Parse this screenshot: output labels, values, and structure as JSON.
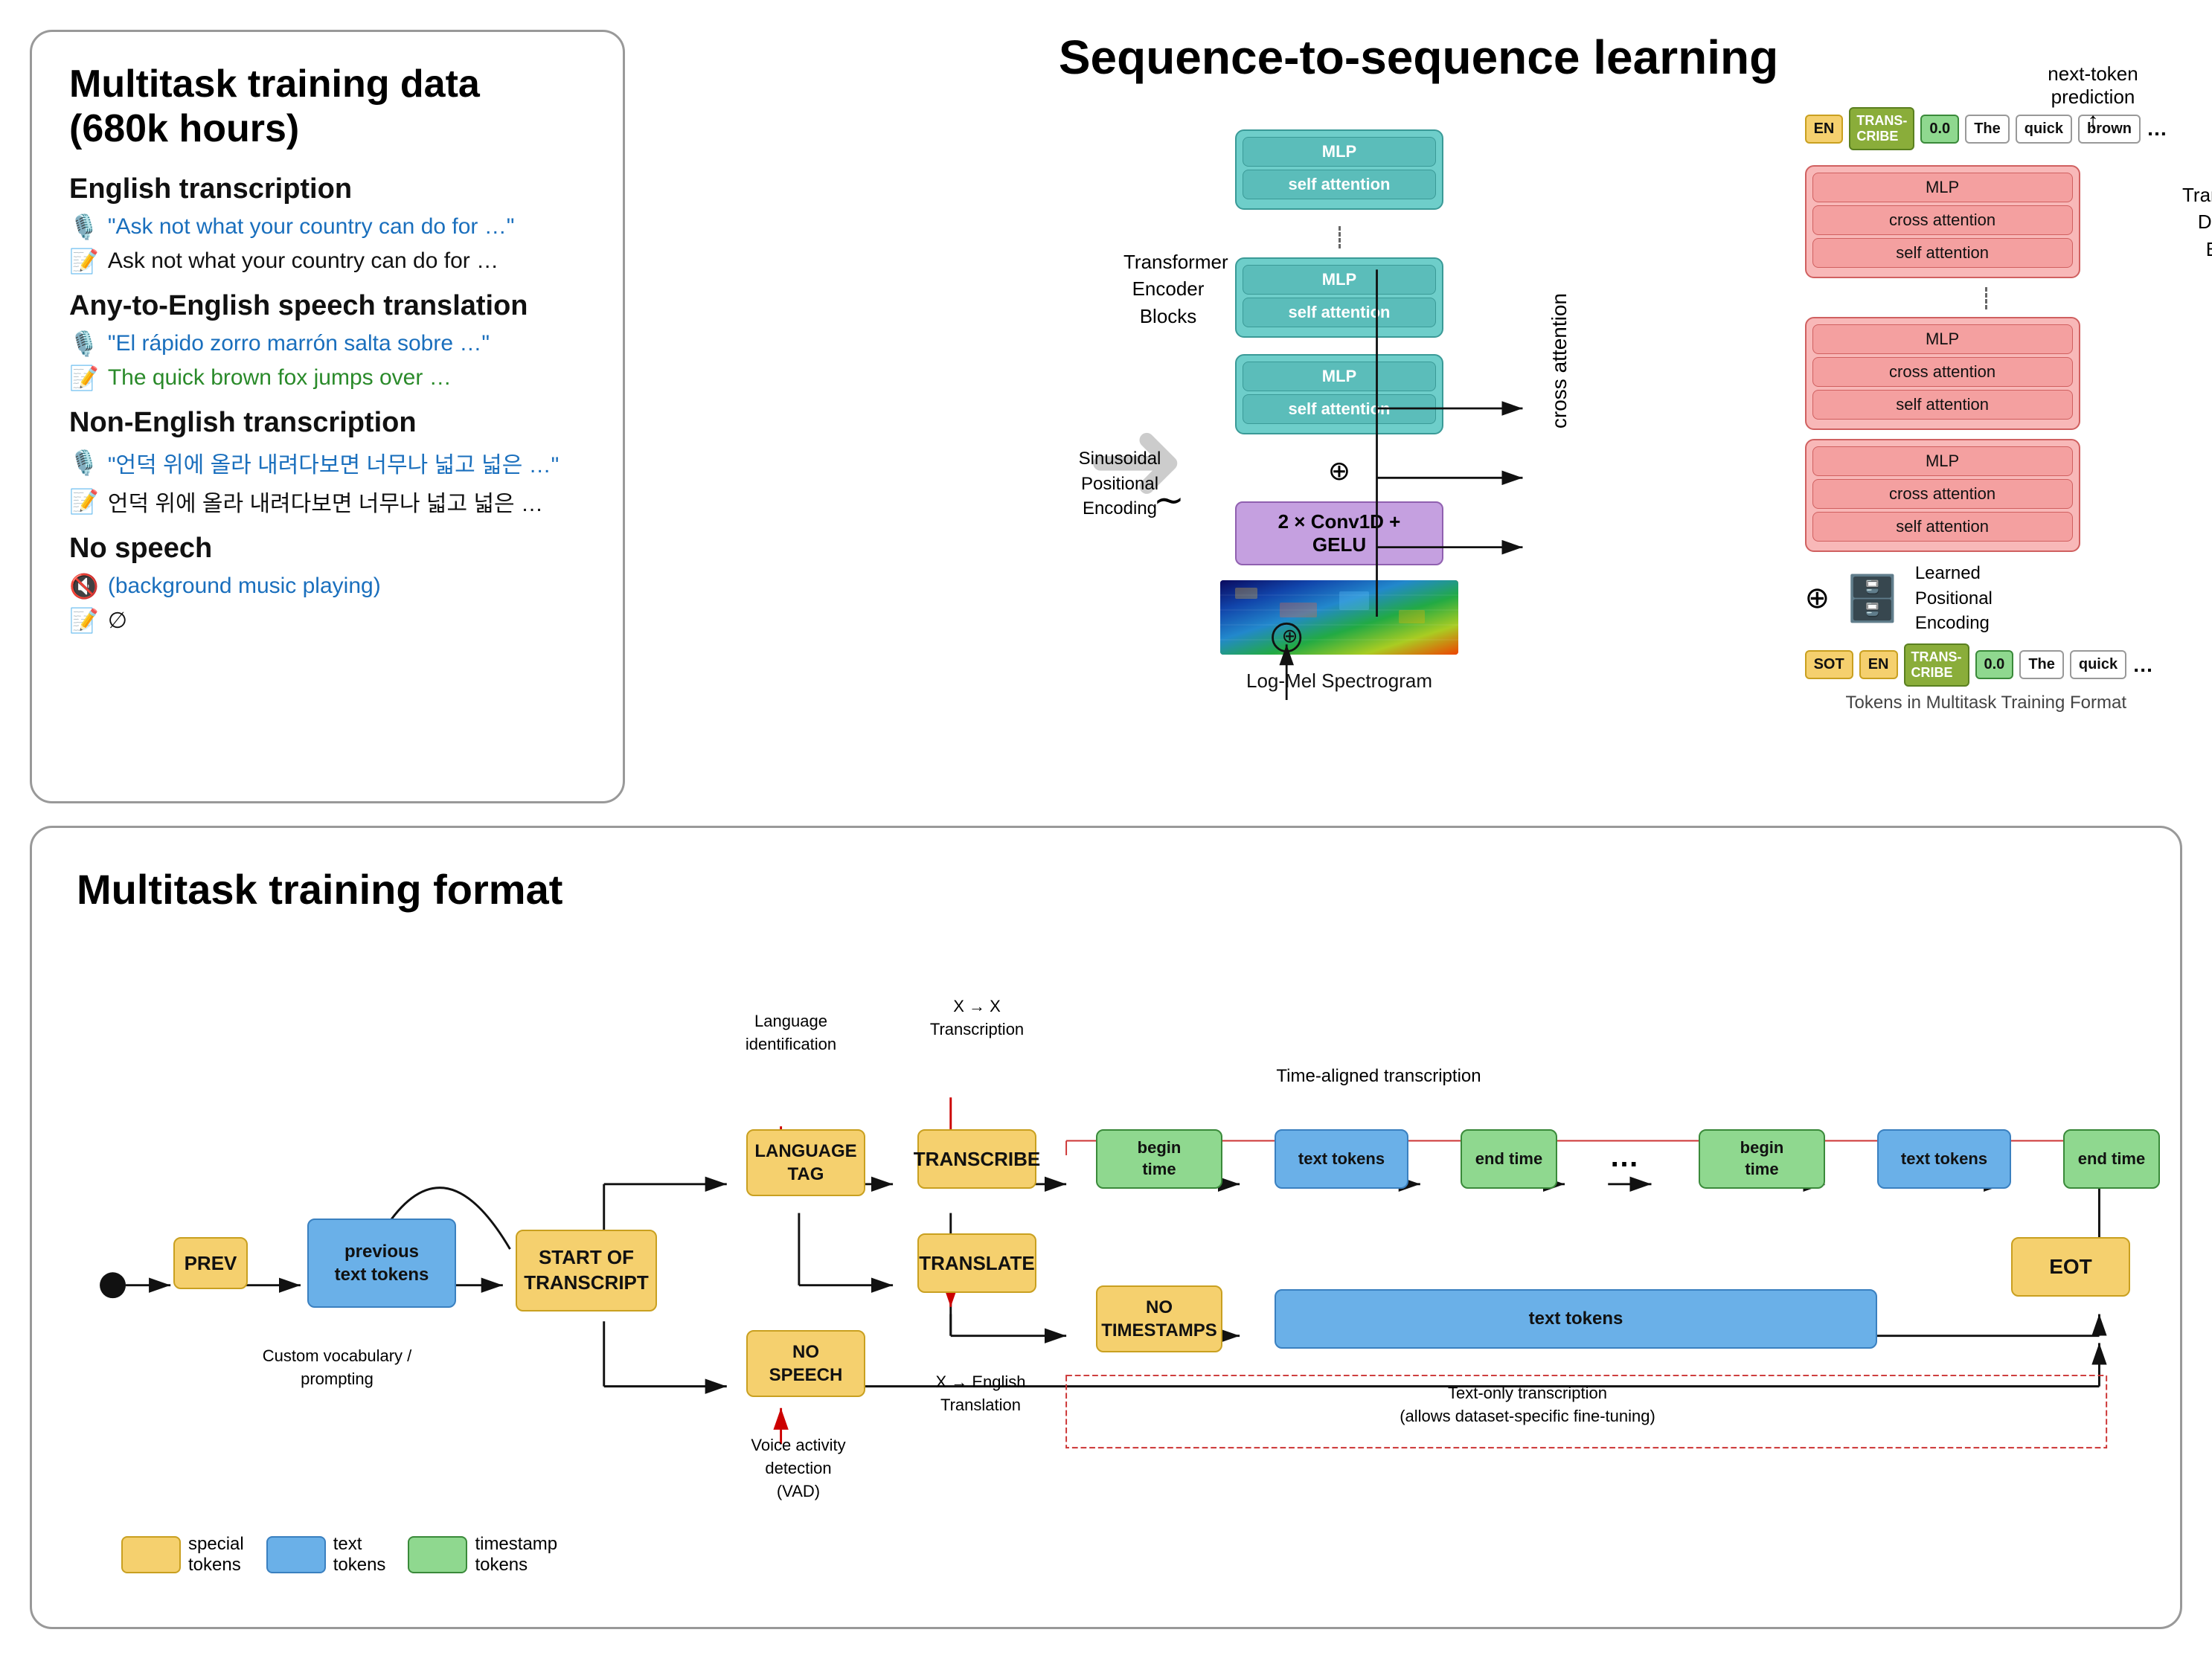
{
  "top_left": {
    "title": "Multitask training data (680k hours)",
    "sections": [
      {
        "heading": "English transcription",
        "items": [
          {
            "icon": "🎙️",
            "text": "\"Ask not what your country can do for …\"",
            "color": "blue"
          },
          {
            "icon": "📝",
            "text": "Ask not what your country can do for …",
            "color": "black"
          }
        ]
      },
      {
        "heading": "Any-to-English speech translation",
        "items": [
          {
            "icon": "🎙️",
            "text": "\"El rápido zorro marrón salta sobre …\"",
            "color": "blue"
          },
          {
            "icon": "📝",
            "text": "The quick brown fox jumps over …",
            "color": "green"
          }
        ]
      },
      {
        "heading": "Non-English transcription",
        "items": [
          {
            "icon": "🎙️",
            "text": "\"언덕 위에 올라 내려다보면 너무나 넓고 넓은 …\"",
            "color": "blue"
          },
          {
            "icon": "📝",
            "text": "언덕 위에 올라 내려다보면 너무나 넓고 넓은 …",
            "color": "black"
          }
        ]
      },
      {
        "heading": "No speech",
        "items": [
          {
            "icon": "🔇",
            "text": "(background music playing)",
            "color": "blue"
          },
          {
            "icon": "📝",
            "text": "∅",
            "color": "black"
          }
        ]
      }
    ]
  },
  "top_right": {
    "title": "Sequence-to-sequence learning",
    "encoder_label": "Transformer\nEncoder Blocks",
    "decoder_label": "Transformer\nDecoder Blocks",
    "blocks": {
      "encoder": [
        "MLP",
        "self attention"
      ],
      "decoder": [
        "MLP",
        "cross attention",
        "self attention"
      ]
    },
    "conv_label": "2 × Conv1D + GELU",
    "spectrogram_label": "Log-Mel Spectrogram",
    "encoding_label": "Sinusoidal\nPositional\nEncoding",
    "learned_encoding_label": "Learned\nPositional\nEncoding",
    "cross_attention_label": "cross attention",
    "next_token_label": "next-token\nprediction",
    "tokens_top": [
      "EN",
      "TRANS-\nCRIBE",
      "0.0",
      "The",
      "quick",
      "brown",
      "…"
    ],
    "tokens_bottom": [
      "SOT",
      "EN",
      "TRANS-\nCRIBE",
      "0.0",
      "The",
      "quick",
      "…"
    ],
    "tokens_bottom_label": "Tokens in Multitask Training Format"
  },
  "bottom": {
    "title": "Multitask training format",
    "nodes": {
      "prev": "PREV",
      "prev_text": "previous\ntext tokens",
      "start_transcript": "START OF\nTRANSCRIPT",
      "language_tag": "LANGUAGE\nTAG",
      "no_speech": "NO\nSPEECH",
      "transcribe": "TRANSCRIBE",
      "translate": "TRANSLATE",
      "begin_time1": "begin\ntime",
      "text_tokens1": "text tokens",
      "end_time1": "end time",
      "dots1": "…",
      "begin_time2": "begin\ntime",
      "text_tokens2": "text tokens",
      "end_time2": "end time",
      "no_timestamps": "NO\nTIMESTAMPS",
      "text_tokens_wide": "text tokens",
      "eot": "EOT"
    },
    "labels": {
      "language_id": "Language\nidentification",
      "x_to_x": "X → X\nTranscription",
      "x_to_en": "X → English\nTranslation",
      "vad": "Voice activity\ndetection\n(VAD)",
      "custom_vocab": "Custom vocabulary /\nprompting",
      "time_aligned": "Time-aligned transcription",
      "text_only": "Text-only transcription\n(allows dataset-specific fine-tuning)"
    },
    "legend": [
      {
        "label": "special\ntokens",
        "color": "yellow"
      },
      {
        "label": "text\ntokens",
        "color": "blue"
      },
      {
        "label": "timestamp\ntokens",
        "color": "green"
      }
    ]
  }
}
